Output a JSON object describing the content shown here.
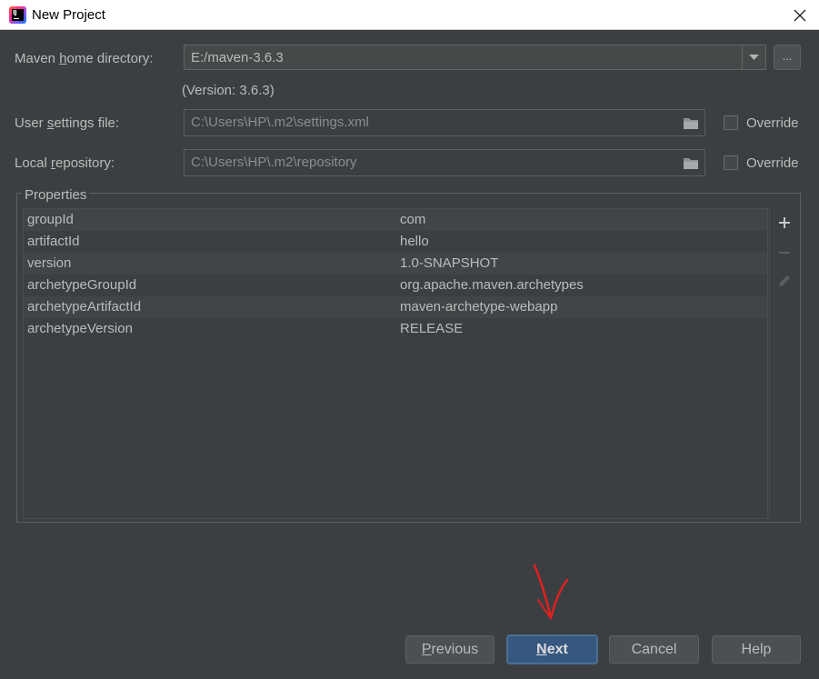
{
  "window": {
    "title": "New Project",
    "icon": "intellij-idea-icon",
    "close_icon": "close-icon"
  },
  "maven_home": {
    "label_before": "Maven ",
    "label_mnemonic": "h",
    "label_after": "ome directory:",
    "value": "E:/maven-3.6.3",
    "browse_label": "...",
    "version": "(Version: 3.6.3)"
  },
  "user_settings": {
    "label_before": "User ",
    "label_mnemonic": "s",
    "label_after": "ettings file:",
    "value": "C:\\Users\\HP\\.m2\\settings.xml",
    "override_label": "Override",
    "override_checked": false
  },
  "local_repository": {
    "label_before": "Local ",
    "label_mnemonic": "r",
    "label_after": "epository:",
    "value": "C:\\Users\\HP\\.m2\\repository",
    "override_label": "Override",
    "override_checked": false
  },
  "properties": {
    "title": "Properties",
    "rows": [
      {
        "key": "groupId",
        "value": "com"
      },
      {
        "key": "artifactId",
        "value": "hello"
      },
      {
        "key": "version",
        "value": "1.0-SNAPSHOT"
      },
      {
        "key": "archetypeGroupId",
        "value": "org.apache.maven.archetypes"
      },
      {
        "key": "archetypeArtifactId",
        "value": "maven-archetype-webapp"
      },
      {
        "key": "archetypeVersion",
        "value": "RELEASE"
      }
    ],
    "tools": [
      "add-icon",
      "remove-icon",
      "edit-icon"
    ]
  },
  "buttons": {
    "previous_mnemonic": "P",
    "previous_rest": "revious",
    "next_mnemonic": "N",
    "next_rest": "ext",
    "cancel": "Cancel",
    "help": "Help"
  },
  "colors": {
    "background": "#3c3f41",
    "text": "#bbbbbb",
    "default_button": "#365880",
    "annotation": "#e02020"
  }
}
